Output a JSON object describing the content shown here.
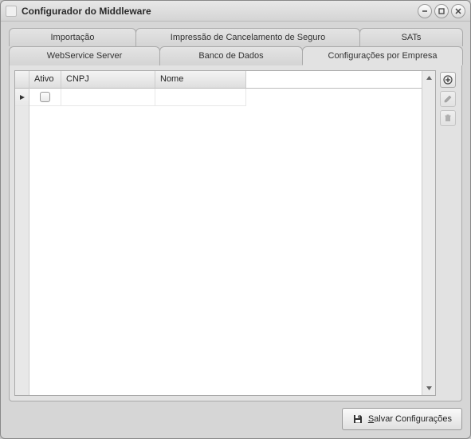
{
  "window": {
    "title": "Configurador do Middleware"
  },
  "tabs": {
    "row1": [
      {
        "label": "Importação"
      },
      {
        "label": "Impressão de Cancelamento de Seguro"
      },
      {
        "label": "SATs"
      }
    ],
    "row2": [
      {
        "label": "WebService Server"
      },
      {
        "label": "Banco de Dados"
      },
      {
        "label": "Configurações por Empresa",
        "active": true
      }
    ]
  },
  "grid": {
    "columns": {
      "ativo": "Ativo",
      "cnpj": "CNPJ",
      "nome": "Nome"
    },
    "rows": [
      {
        "ativo": false,
        "cnpj": "",
        "nome": ""
      }
    ]
  },
  "buttons": {
    "save": "Salvar Configurações",
    "save_underline": "S",
    "save_rest": "alvar Configurações"
  },
  "icons": {
    "add": "plus-icon",
    "edit": "pencil-icon",
    "delete": "trash-icon",
    "save": "floppy-icon"
  }
}
